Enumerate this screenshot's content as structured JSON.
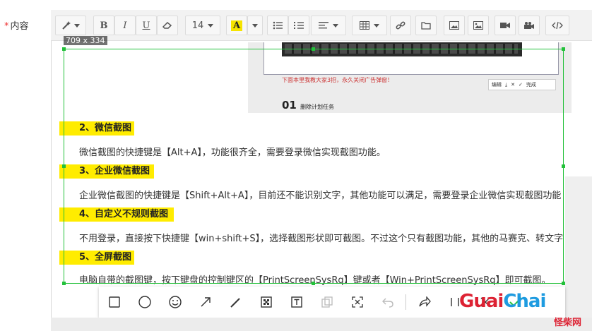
{
  "label": {
    "required_mark": "*",
    "text": "内容"
  },
  "toolbar": {
    "font_size": "14",
    "highlight_letter": "A",
    "bold": "B",
    "italic": "I",
    "underline": "U"
  },
  "selection": {
    "dimensions": "709 x 334"
  },
  "embedded_shot": {
    "promo_text": "下面本里我教大家3招，永久关闭广告弹窗！",
    "step_number": "01",
    "step_text": "删除计划任务",
    "edit_label": "编辑",
    "done_label": "完成"
  },
  "article": [
    {
      "heading": "2、微信截图",
      "text": "微信截图的快捷键是【Alt+A】，功能很齐全，需要登录微信实现截图功能。"
    },
    {
      "heading": "3、企业微信截图",
      "text": "企业微信截图的快捷键是【Shift+Alt+A】，目前还不能识别文字，其他功能可以满足，需要登录企业微信实现截图功能"
    },
    {
      "heading": "4、自定义不规则截图",
      "text": "不用登录，直接按下快捷键【win+shift+S】，选择截图形状即可截图。不过这个只有截图功能，其他的马赛克、转文字"
    },
    {
      "heading": "5、全屏截图",
      "text": "电脑自带的截图键，按下键盘的控制键区的【PrintScreenSysRq】键或者【Win+PrintScreenSysRq】即可截图。"
    }
  ],
  "watermark": {
    "main_a": "Guai",
    "main_b": "Chai",
    "sub": "怪柴网"
  },
  "colors": {
    "highlight": "#ffec00",
    "selection": "#23c13a",
    "brand_red": "#dd2233",
    "brand_blue": "#1e9be0"
  }
}
